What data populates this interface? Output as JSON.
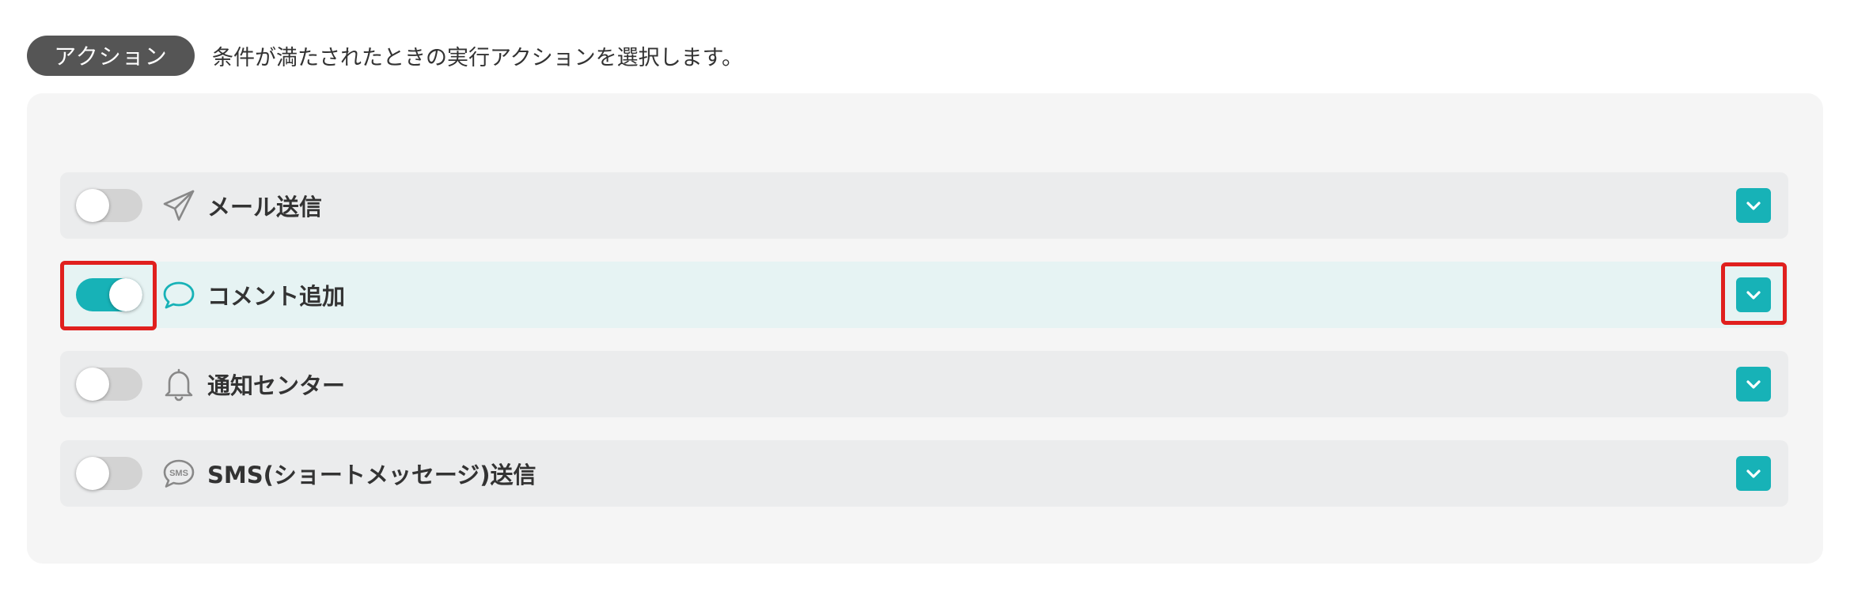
{
  "header": {
    "badge_label": "アクション",
    "description": "条件が満たされたときの実行アクションを選択します。"
  },
  "colors": {
    "accent": "#17b2b7",
    "highlight": "#e0201e",
    "badge_bg": "#555555"
  },
  "actions": [
    {
      "label": "メール送信",
      "icon": "paper-plane-icon",
      "enabled": false,
      "highlighted": false
    },
    {
      "label": "コメント追加",
      "icon": "speech-bubble-icon",
      "enabled": true,
      "highlighted": true
    },
    {
      "label": "通知センター",
      "icon": "bell-icon",
      "enabled": false,
      "highlighted": false
    },
    {
      "label": "SMS(ショートメッセージ)送信",
      "icon": "sms-bubble-icon",
      "enabled": false,
      "highlighted": false,
      "icon_text": "SMS"
    }
  ]
}
